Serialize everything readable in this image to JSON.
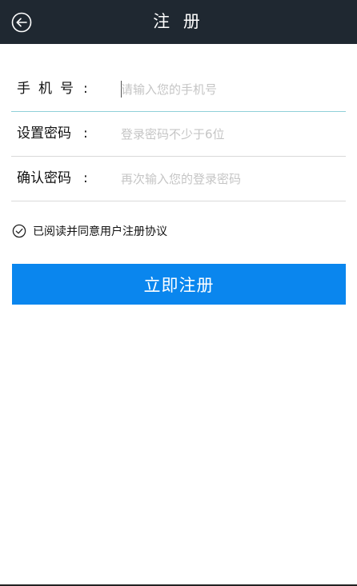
{
  "header": {
    "title": "注 册"
  },
  "form": {
    "phone": {
      "label": "手机号",
      "colon": ":",
      "value": "",
      "placeholder": "请输入您的手机号"
    },
    "password": {
      "label": "设置密码",
      "colon": ":",
      "value": "",
      "placeholder": "登录密码不少于6位"
    },
    "confirm": {
      "label": "确认密码",
      "colon": ":",
      "value": "",
      "placeholder": "再次输入您的登录密码"
    }
  },
  "agreement": {
    "text": "已阅读并同意用户注册协议",
    "checked": true,
    "icon": "check-circle-icon"
  },
  "submit": {
    "label": "立即注册"
  },
  "colors": {
    "header_bg": "#1f2831",
    "accent": "#0a86ee",
    "active_underline": "#8fd0d9"
  }
}
